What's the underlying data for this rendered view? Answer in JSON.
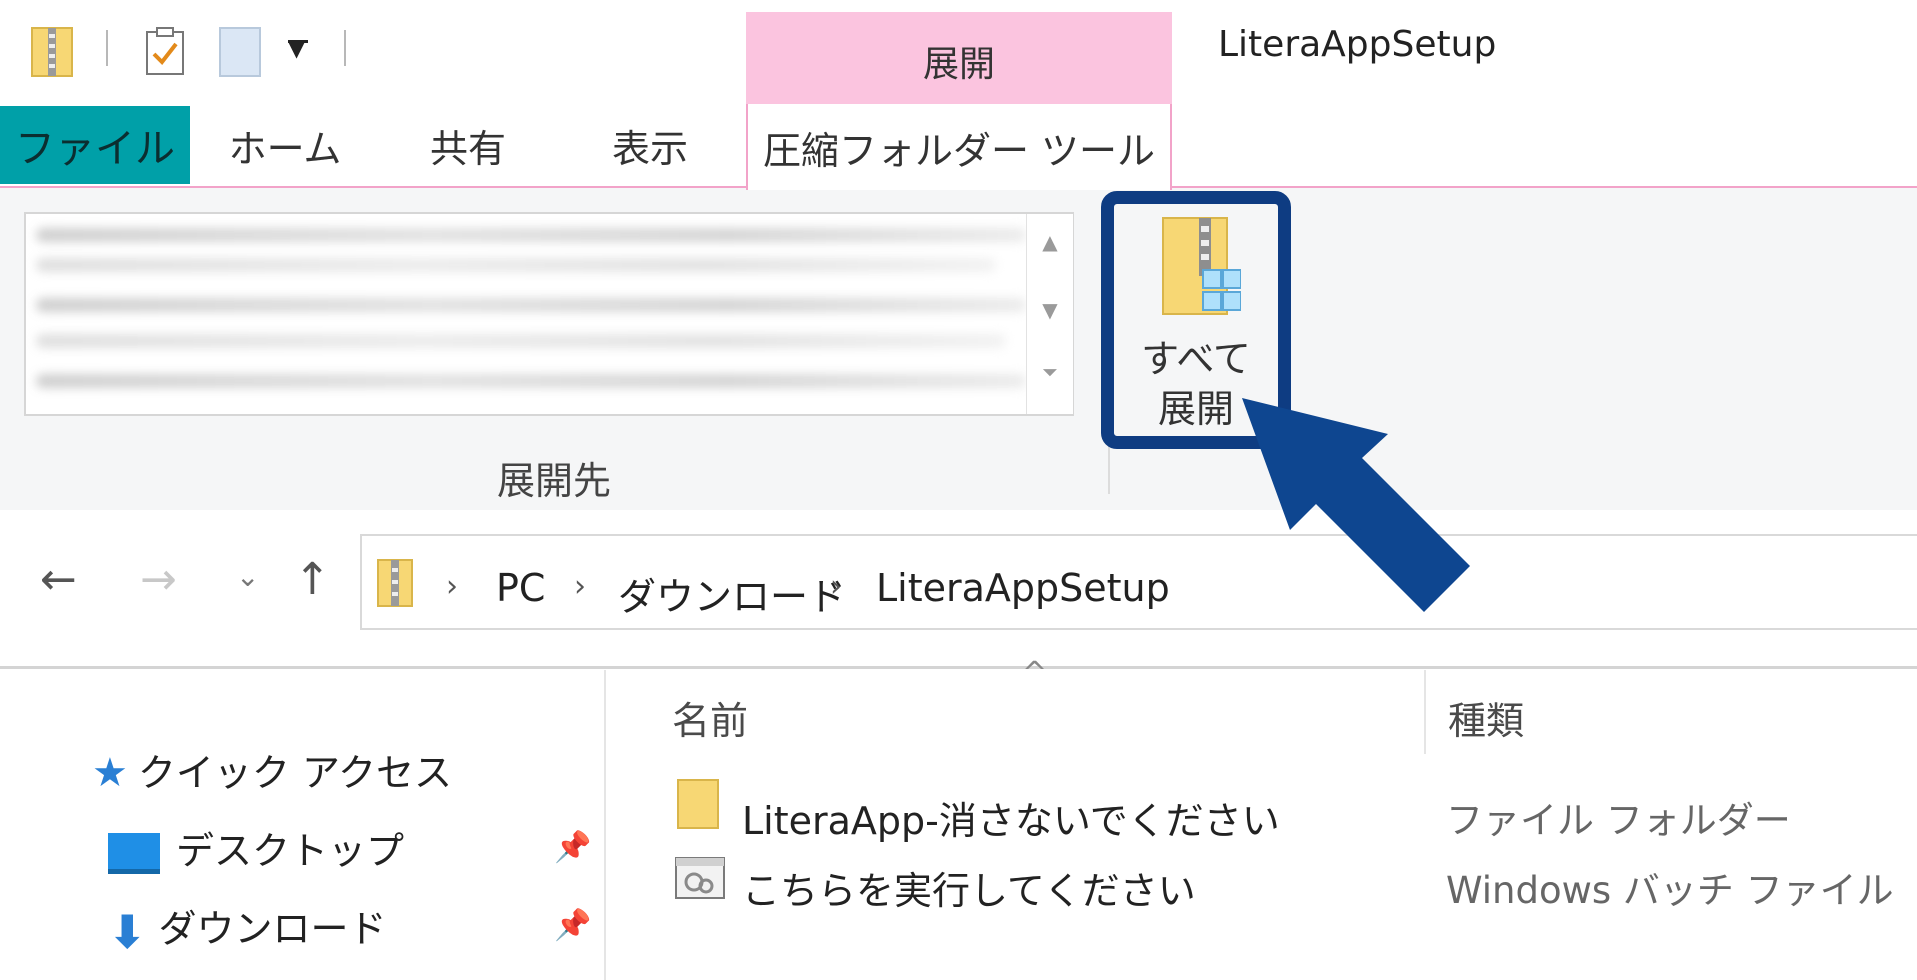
{
  "titlebar": {
    "context_tab_header": "展開",
    "window_title": "LiteraAppSetup"
  },
  "tabs": [
    {
      "label": "ファイル"
    },
    {
      "label": "ホーム"
    },
    {
      "label": "共有"
    },
    {
      "label": "表示"
    },
    {
      "label": "圧縮フォルダー ツール"
    }
  ],
  "ribbon": {
    "destination_group_label": "展開先",
    "extract_all_label": "すべて\n展開"
  },
  "address_bar": {
    "breadcrumbs": [
      "PC",
      "ダウンロード",
      "LiteraAppSetup"
    ]
  },
  "nav_pane": {
    "items": [
      {
        "label": "クイック アクセス",
        "icon": "star-icon"
      },
      {
        "label": "デスクトップ",
        "icon": "desktop-icon"
      },
      {
        "label": "ダウンロード",
        "icon": "download-arrow-icon"
      }
    ]
  },
  "file_list": {
    "columns": [
      "名前",
      "種類"
    ],
    "rows": [
      {
        "name": "LiteraApp-消さないでください",
        "type": "ファイル フォルダー",
        "icon": "folder-icon"
      },
      {
        "name": "こちらを実行してください",
        "type": "Windows バッチ ファイル",
        "icon": "batch-file-icon"
      }
    ]
  },
  "colors": {
    "file_tab": "#00a0a8",
    "context_tab": "#fbc4df",
    "highlight": "#0e3c82",
    "arrow": "#0e4690",
    "folder": "#f7d774"
  }
}
